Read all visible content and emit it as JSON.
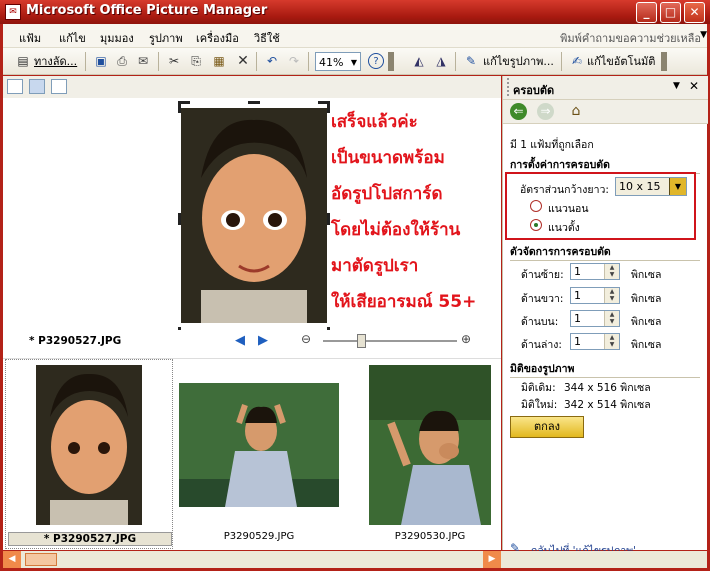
{
  "window": {
    "title": "Microsoft Office Picture Manager"
  },
  "menu": [
    "แฟ้ม",
    "แก้ไข",
    "มุมมอง",
    "รูปภาพ",
    "เครื่องมือ",
    "วิธีใช้"
  ],
  "help_placeholder": "พิมพ์คำถามขอความช่วยเหลือ",
  "toolbar": {
    "shortcut_label": "ทางลัด...",
    "zoom_value": "41%",
    "edit_pictures_label": "แก้ไขรูปภาพ...",
    "auto_correct_label": "แก้ไขอัตโนมัติ"
  },
  "overlay_lines": [
    "เสร็จแล้วค่ะ",
    "เป็นขนาดพร้อม",
    "อัดรูปโปสการ์ด",
    "โดยไม่ต้องให้ร้าน",
    "มาตัดรูปเรา",
    "ให้เสียอารมณ์ 55+"
  ],
  "preview_filename": "* P3290527.JPG",
  "thumbnails": [
    {
      "label": "* P3290527.JPG",
      "selected": true
    },
    {
      "label": "P3290529.JPG",
      "selected": false
    },
    {
      "label": "P3290530.JPG",
      "selected": false
    }
  ],
  "task_pane": {
    "title": "ครอบตัด",
    "selection_info": "มี 1 แฟ้มที่ถูกเลือก",
    "crop_settings_heading": "การตั้งค่าการครอบตัด",
    "aspect_ratio_label": "อัตราส่วนกว้างยาว:",
    "aspect_ratio_value": "10 x 15",
    "landscape_label": "แนวนอน",
    "portrait_label": "แนวตั้ง",
    "crop_handles_heading": "ตัวจัดการการครอบตัด",
    "margins": [
      {
        "label": "ด้านซ้าย:",
        "value": "1",
        "unit": "พิกเซล"
      },
      {
        "label": "ด้านขวา:",
        "value": "1",
        "unit": "พิกเซล"
      },
      {
        "label": "ด้านบน:",
        "value": "1",
        "unit": "พิกเซล"
      },
      {
        "label": "ด้านล่าง:",
        "value": "1",
        "unit": "พิกเซล"
      }
    ],
    "dimensions_heading": "มิติของรูปภาพ",
    "original_label": "มิติเดิม:",
    "original_value": "344 x 516 พิกเซล",
    "new_label": "มิติใหม่:",
    "new_value": "342 x 514 พิกเซล",
    "ok_label": "ตกลง",
    "back_link": "กลับไปที่ 'แก้ไขรูปภาพ'"
  },
  "colors": {
    "accent": "#b32218",
    "overlay_text": "#e2141b",
    "highlight_box": "#d0141b"
  }
}
